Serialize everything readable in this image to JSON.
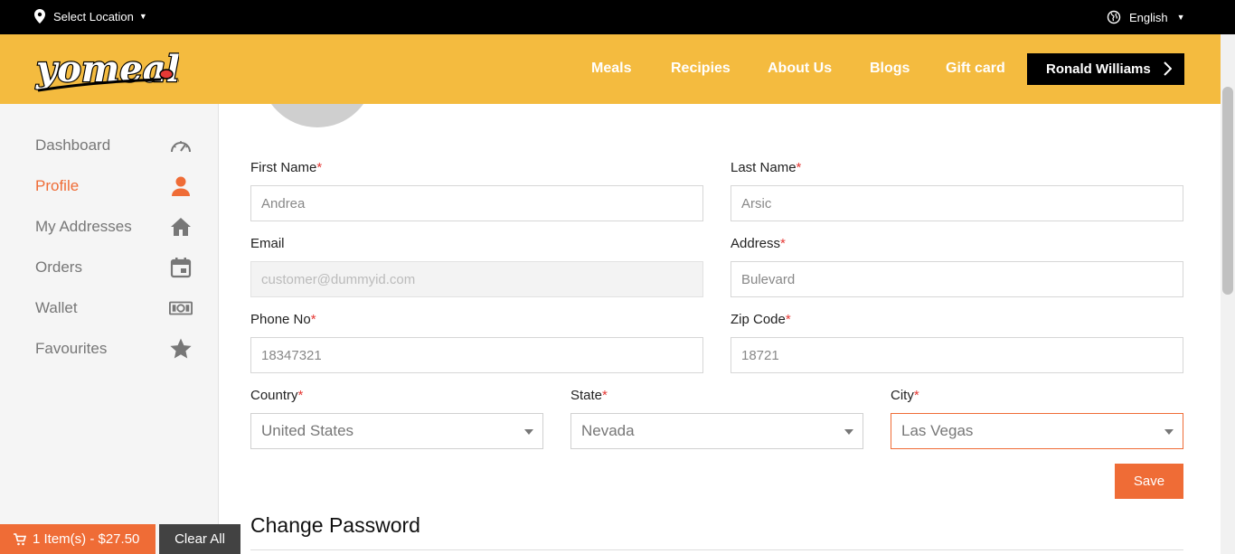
{
  "topbar": {
    "location_label": "Select Location",
    "language_label": "English"
  },
  "header": {
    "brand": "yomeals",
    "nav": [
      "Meals",
      "Recipies",
      "About Us",
      "Blogs",
      "Gift card"
    ],
    "user_name": "Ronald Williams",
    "accent_color": "#f4bb3f"
  },
  "sidebar": {
    "items": [
      {
        "label": "Dashboard",
        "icon": "speedometer-icon"
      },
      {
        "label": "Profile",
        "icon": "user-icon",
        "active": true
      },
      {
        "label": "My Addresses",
        "icon": "home-icon"
      },
      {
        "label": "Orders",
        "icon": "calendar-icon"
      },
      {
        "label": "Wallet",
        "icon": "money-icon"
      },
      {
        "label": "Favourites",
        "icon": "star-icon"
      }
    ]
  },
  "form": {
    "first_name_label": "First Name",
    "first_name_value": "Andrea",
    "last_name_label": "Last Name",
    "last_name_value": "Arsic",
    "email_label": "Email",
    "email_value": "customer@dummyid.com",
    "address_label": "Address",
    "address_value": "Bulevard",
    "phone_label": "Phone No",
    "phone_value": "18347321",
    "zip_label": "Zip Code",
    "zip_value": "18721",
    "country_label": "Country",
    "country_value": "United States",
    "state_label": "State",
    "state_value": "Nevada",
    "city_label": "City",
    "city_value": "Las Vegas",
    "required_mark": "*",
    "save_label": "Save"
  },
  "change_password": {
    "title": "Change Password"
  },
  "cart": {
    "summary": "1 Item(s) - $27.50",
    "clear_label": "Clear All",
    "color": "#ef6c36"
  }
}
